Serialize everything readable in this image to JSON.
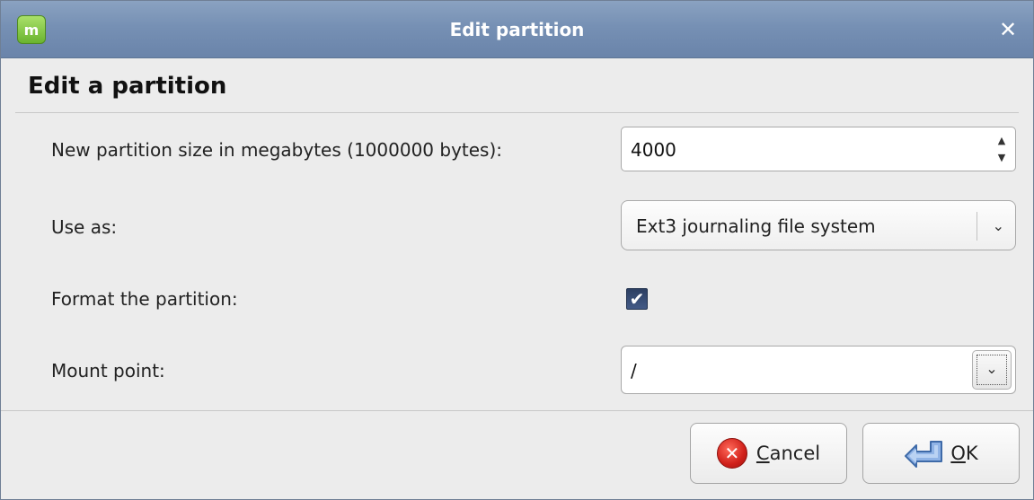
{
  "window": {
    "title": "Edit partition",
    "app_icon_glyph": "m",
    "close_glyph": "✕"
  },
  "form": {
    "heading": "Edit a partition",
    "size_label": "New partition size in megabytes (1000000 bytes):",
    "size_value": "4000",
    "use_as_label": "Use as:",
    "use_as_value": "Ext3 journaling file system",
    "format_label": "Format the partition:",
    "format_checked": true,
    "mount_label": "Mount point:",
    "mount_value": "/"
  },
  "buttons": {
    "cancel_mnemonic": "C",
    "cancel_rest": "ancel",
    "ok_mnemonic": "O",
    "ok_rest": "K"
  },
  "icons": {
    "app": "linux-mint-icon",
    "close": "close-icon",
    "cancel": "cancel-icon",
    "ok": "ok-arrow-icon"
  },
  "colors": {
    "titlebar": "#7690b4",
    "checkbox": "#2c3f62",
    "cancel_red": "#d0201a",
    "ok_blue": "#6f97d0"
  }
}
